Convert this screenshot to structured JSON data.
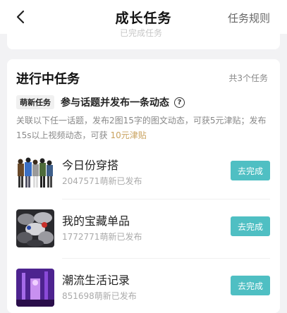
{
  "header": {
    "title": "成长任务",
    "rules_link": "任务规则",
    "back_icon": "chevron-left-icon"
  },
  "top_card": {
    "faded_text": "已完成任务"
  },
  "section": {
    "title": "进行中任务",
    "count": "共3个任务",
    "task": {
      "badge": "萌新任务",
      "name": "参与话题并发布一条动态",
      "help_icon": "question-circle-icon",
      "desc_main": "关联以下任一话题，发布2图15字的图文动态，可获5元津贴；发布15s以上视频动态，可获",
      "desc_reward": "10元津贴"
    },
    "topics": [
      {
        "title": "今日份穿搭",
        "count": "2047571萌新已发布",
        "button": "去完成"
      },
      {
        "title": "我的宝藏单品",
        "count": "1772771萌新已发布",
        "button": "去完成"
      },
      {
        "title": "潮流生活记录",
        "count": "851698萌新已发布",
        "button": "去完成"
      }
    ]
  },
  "colors": {
    "accent": "#4fbfc3",
    "reward": "#c9a25e"
  }
}
